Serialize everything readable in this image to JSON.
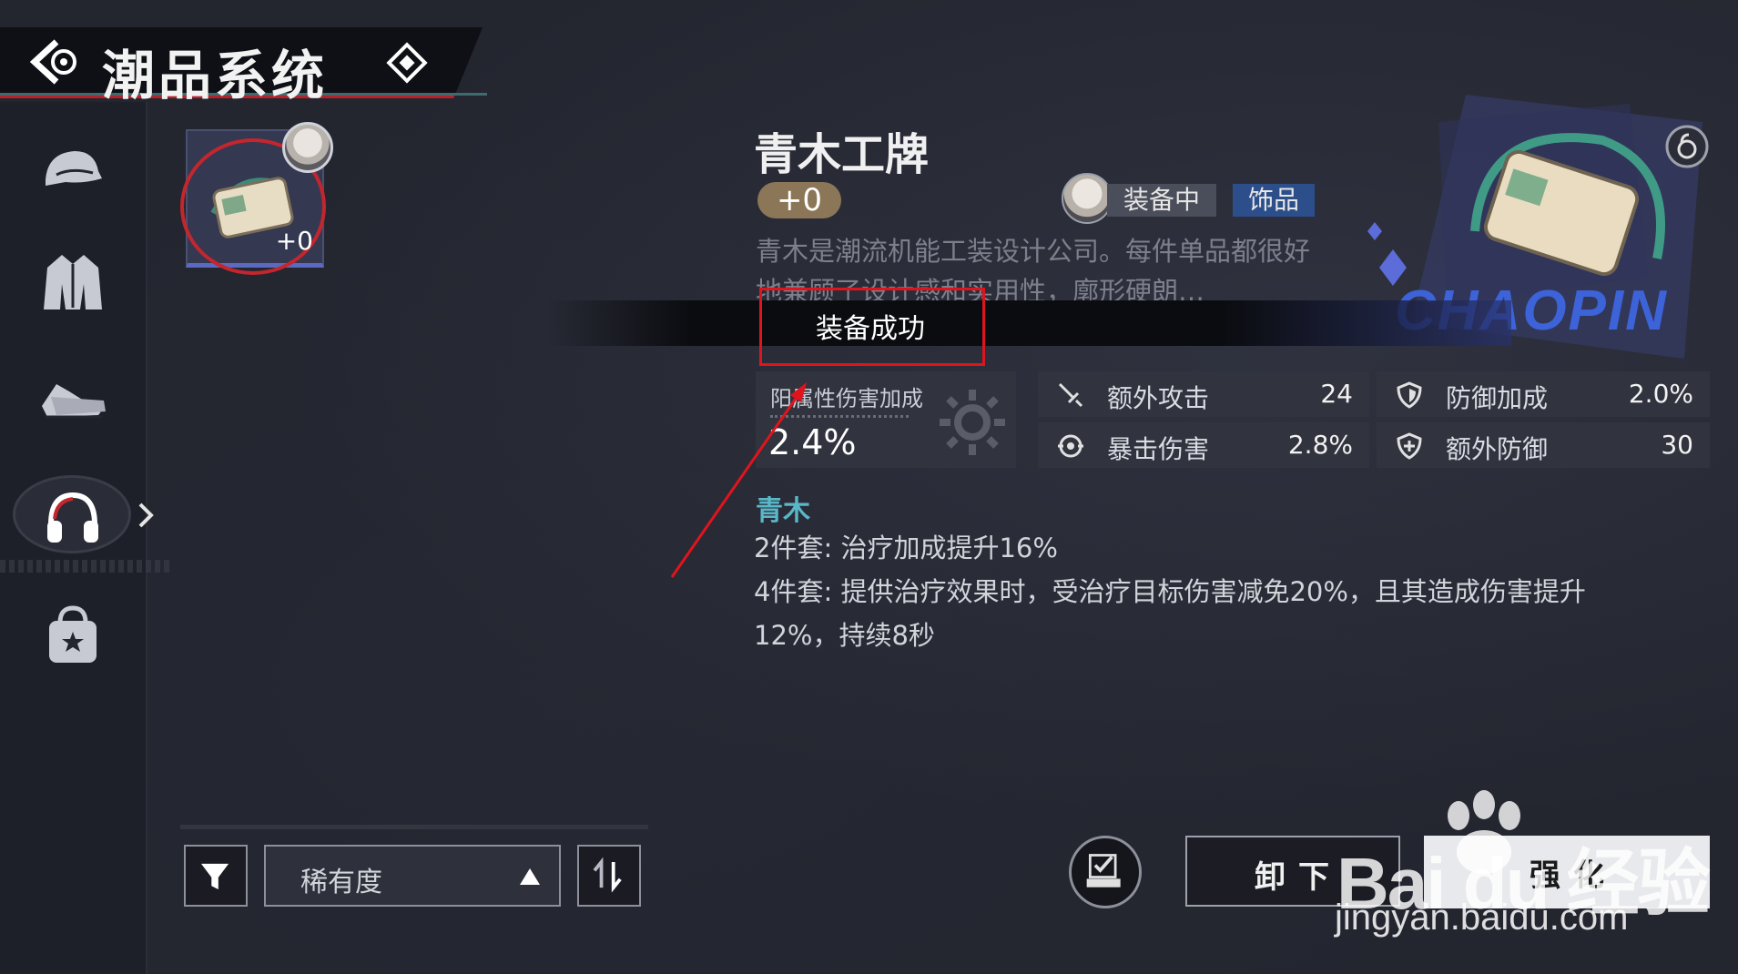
{
  "header": {
    "title": "潮品系统"
  },
  "sidebar": {
    "items": [
      {
        "name": "cap-icon"
      },
      {
        "name": "jacket-icon"
      },
      {
        "name": "sneakers-icon"
      },
      {
        "name": "headphones-icon",
        "active": true
      },
      {
        "name": "bag-icon"
      }
    ]
  },
  "item_card": {
    "level": "+0"
  },
  "detail": {
    "name": "青木工牌",
    "level": "+0",
    "status_tag": "装备中",
    "type_tag": "饰品",
    "description": "青木是潮流机能工装设计公司。每件单品都很好地兼顾了设计感和实用性，廓形硬朗…",
    "toast": "装备成功",
    "main_stat": {
      "label": "阳属性伤害加成",
      "value": "2.4%"
    },
    "sub_stats": [
      {
        "label": "额外攻击",
        "value": "24",
        "icon": "sword-icon"
      },
      {
        "label": "防御加成",
        "value": "2.0%",
        "icon": "shield-icon"
      },
      {
        "label": "暴击伤害",
        "value": "2.8%",
        "icon": "crit-icon"
      },
      {
        "label": "额外防御",
        "value": "30",
        "icon": "shield-plus-icon"
      }
    ],
    "set": {
      "name": "青木",
      "bonus2": "2件套: 治疗加成提升16%",
      "bonus4_line1": "4件套: 提供治疗效果时，受治疗目标伤害减免20%，且其造成伤害提升",
      "bonus4_line2": "12%，持续8秒"
    },
    "art_text": "CHAOPIN"
  },
  "bottom": {
    "sort_label": "稀有度",
    "unequip_label": "卸下",
    "enhance_label": "强化"
  },
  "watermark": {
    "main": "Bai du 经验",
    "sub": "jingyan.baidu.com"
  },
  "colors": {
    "accent_red": "#c4262e",
    "set_name": "#5ab7c8",
    "accessory_tag": "#2c4f8c"
  }
}
